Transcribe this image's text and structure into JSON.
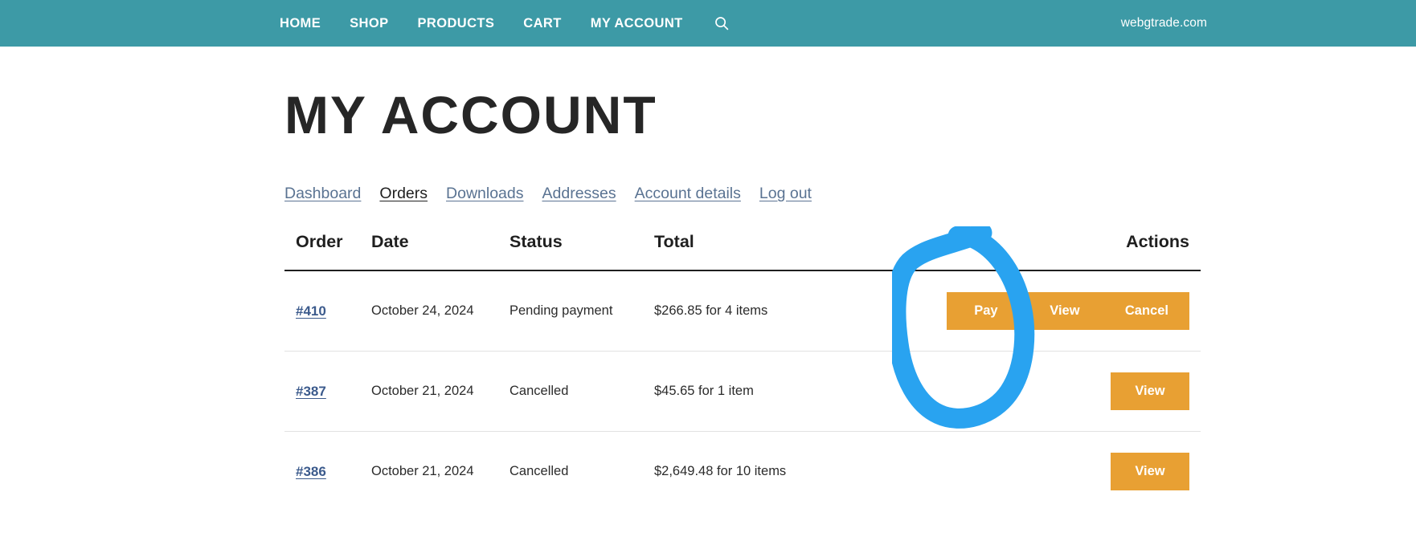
{
  "header": {
    "background_color": "#3d9aa6",
    "nav_items": [
      {
        "label": "HOME"
      },
      {
        "label": "SHOP"
      },
      {
        "label": "PRODUCTS"
      },
      {
        "label": "CART"
      },
      {
        "label": "MY ACCOUNT"
      }
    ],
    "search_icon": "search-icon",
    "brand": "webgtrade.com"
  },
  "main": {
    "title": "MY ACCOUNT",
    "tabs": [
      {
        "label": "Dashboard",
        "active": false
      },
      {
        "label": "Orders",
        "active": true
      },
      {
        "label": "Downloads",
        "active": false
      },
      {
        "label": "Addresses",
        "active": false
      },
      {
        "label": "Account details",
        "active": false
      },
      {
        "label": "Log out",
        "active": false
      }
    ],
    "orders_table": {
      "columns": {
        "order": "Order",
        "date": "Date",
        "status": "Status",
        "total": "Total",
        "actions": "Actions"
      },
      "rows": [
        {
          "order": "#410",
          "date": "October 24, 2024",
          "status": "Pending payment",
          "total": "$266.85 for 4 items",
          "actions": [
            "Pay",
            "View",
            "Cancel"
          ]
        },
        {
          "order": "#387",
          "date": "October 21, 2024",
          "status": "Cancelled",
          "total": "$45.65 for 1 item",
          "actions": [
            "View"
          ]
        },
        {
          "order": "#386",
          "date": "October 21, 2024",
          "status": "Cancelled",
          "total": "$2,649.48 for 10 items",
          "actions": [
            "View"
          ]
        }
      ]
    }
  },
  "annotation": {
    "shape": "hand-drawn-blue-circle",
    "color": "#29a3f0"
  },
  "colors": {
    "header_teal": "#3d9aa6",
    "button_orange": "#e8a033",
    "link_blue": "#3b5a8c",
    "tab_blue": "#5a7392",
    "annotation_blue": "#29a3f0"
  }
}
